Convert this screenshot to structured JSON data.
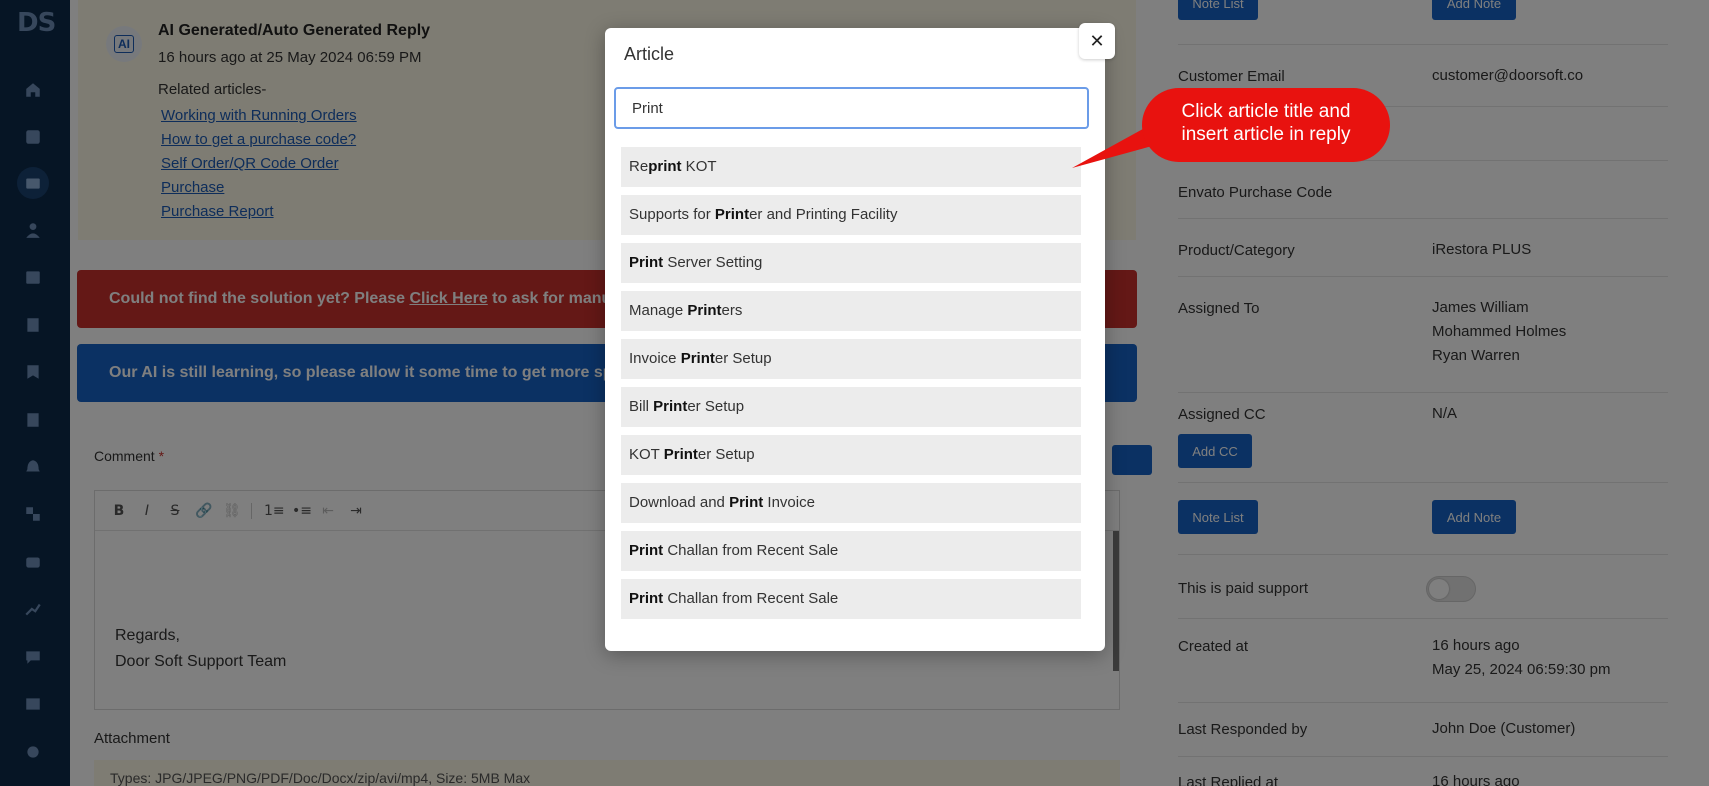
{
  "sidebar": {
    "logo": "DS",
    "icons": [
      "home-icon",
      "dashboard-icon",
      "ticket-icon",
      "user-icon",
      "calendar-icon",
      "book-icon",
      "bookmark-icon",
      "document-icon",
      "bell-icon",
      "sitemap-icon",
      "inbox-icon",
      "chart-icon",
      "chat-icon",
      "image-icon",
      "settings-icon"
    ]
  },
  "ai_reply": {
    "badge": "AI",
    "title": "AI Generated/Auto Generated Reply",
    "time": "16 hours ago at 25 May 2024 06:59 PM",
    "related_label": "Related articles-",
    "links": [
      "Working with Running Orders",
      "How to get a purchase code?",
      "Self Order/QR Code Order",
      "Purchase",
      "Purchase Report"
    ]
  },
  "alerts": {
    "red_prefix": "Could not find the solution yet? Please ",
    "red_link": "Click Here",
    "red_suffix": " to ask for manual a",
    "blue": "Our AI is still learning, so please allow it some time to get more speci"
  },
  "comment": {
    "label": "Comment",
    "required": "*",
    "toolbar": [
      "B",
      "I",
      "S",
      "🔗",
      "⛓",
      "1≡",
      "•≡",
      "⇤",
      "⇥"
    ],
    "signature_line1": "Regards,",
    "signature_line2": "Door Soft Support Team"
  },
  "attachment": {
    "label": "Attachment",
    "hint": "Types: JPG/JPEG/PNG/PDF/Doc/Docx/zip/avi/mp4, Size: 5MB Max"
  },
  "details": {
    "note_list": "Note List",
    "add_note": "Add Note",
    "add_cc": "Add CC",
    "customer_email_label": "Customer Email",
    "customer_email": "customer@doorsoft.co",
    "envato_label": "Envato Purchase Code",
    "product_label": "Product/Category",
    "product": "iRestora PLUS",
    "assigned_to_label": "Assigned To",
    "assigned_to": [
      "James William",
      "Mohammed Holmes",
      "Ryan Warren"
    ],
    "assigned_cc_label": "Assigned CC",
    "assigned_cc": "N/A",
    "paid_label": "This is paid support",
    "paid_enabled": false,
    "created_label": "Created at",
    "created_rel": "16 hours ago",
    "created_abs": "May 25, 2024 06:59:30 pm",
    "responded_label": "Last Responded by",
    "responded_by": "John Doe (Customer)",
    "replied_label": "Last Replied at",
    "replied_at": "16 hours ago"
  },
  "modal": {
    "title": "Article",
    "close": "✕",
    "search_value": "Print",
    "results": [
      {
        "pre": "Re",
        "match": "print",
        "post": " KOT"
      },
      {
        "pre": "Supports for ",
        "match": "Print",
        "post": "er and Printing Facility"
      },
      {
        "pre": "",
        "match": "Print",
        "post": " Server Setting"
      },
      {
        "pre": "Manage ",
        "match": "Print",
        "post": "ers"
      },
      {
        "pre": "Invoice ",
        "match": "Print",
        "post": "er Setup"
      },
      {
        "pre": "Bill ",
        "match": "Print",
        "post": "er Setup"
      },
      {
        "pre": "KOT ",
        "match": "Print",
        "post": "er Setup"
      },
      {
        "pre": "Download and ",
        "match": "Print",
        "post": " Invoice"
      },
      {
        "pre": "",
        "match": "Print",
        "post": " Challan from Recent Sale"
      },
      {
        "pre": "",
        "match": "Print",
        "post": " Challan from Recent Sale"
      }
    ]
  },
  "callout": {
    "line1": "Click article title and",
    "line2": "insert article in reply",
    "color": "#e8120f"
  }
}
